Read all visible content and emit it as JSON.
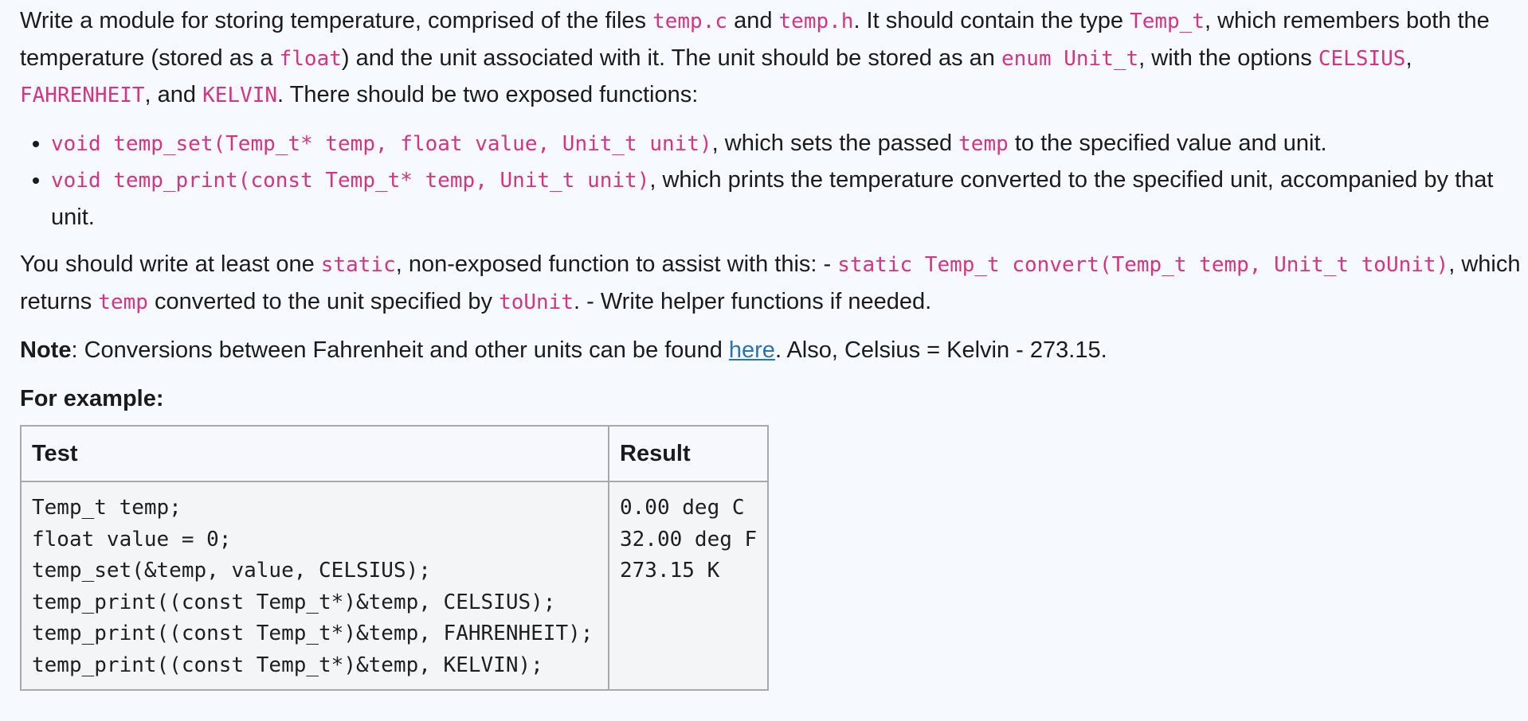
{
  "intro": {
    "t1": "Write a module for storing temperature, comprised of the files ",
    "c1": "temp.c",
    "t2": " and ",
    "c2": "temp.h",
    "t3": ". It should contain the type ",
    "c3": "Temp_t",
    "t4": ", which remembers both the temperature (stored as a ",
    "c4": "float",
    "t5": ") and the unit associated with it. The unit should be stored as an ",
    "c5": "enum Unit_t",
    "t6": ", with the options ",
    "c6": "CELSIUS",
    "t7": ", ",
    "c7": "FAHRENHEIT",
    "t8": ", and ",
    "c8": "KELVIN",
    "t9": ". There should be two exposed functions:"
  },
  "functions": [
    {
      "code": "void temp_set(Temp_t* temp, float value, Unit_t unit)",
      "t1": ", which sets the passed ",
      "code2": "temp",
      "t2": " to the specified value and unit."
    },
    {
      "code": "void temp_print(const Temp_t* temp, Unit_t unit)",
      "t1": ", which prints the temperature converted to the specified unit, accompanied by that unit."
    }
  ],
  "static_para": {
    "t1": "You should write at least one ",
    "c1": "static",
    "t2": ", non-exposed function to assist with this: - ",
    "c2": "static Temp_t convert(Temp_t temp, Unit_t toUnit)",
    "t3": ", which returns ",
    "c3": "temp",
    "t4": " converted to the unit specified by ",
    "c4": "toUnit",
    "t5": ". - Write helper functions if needed."
  },
  "note": {
    "label": "Note",
    "t1": ": Conversions between Fahrenheit and other units can be found ",
    "link": "here",
    "t2": ". Also, Celsius = Kelvin - 273.15."
  },
  "example_heading": "For example:",
  "table": {
    "headers": [
      "Test",
      "Result"
    ],
    "test_code": "Temp_t temp;\nfloat value = 0;\ntemp_set(&temp, value, CELSIUS);\ntemp_print((const Temp_t*)&temp, CELSIUS);\ntemp_print((const Temp_t*)&temp, FAHRENHEIT);\ntemp_print((const Temp_t*)&temp, KELVIN);",
    "result": "0.00 deg C\n32.00 deg F\n273.15 K"
  },
  "colors": {
    "code": "#d63384",
    "link": "#2a73b3",
    "background": "#f6f9fd"
  }
}
